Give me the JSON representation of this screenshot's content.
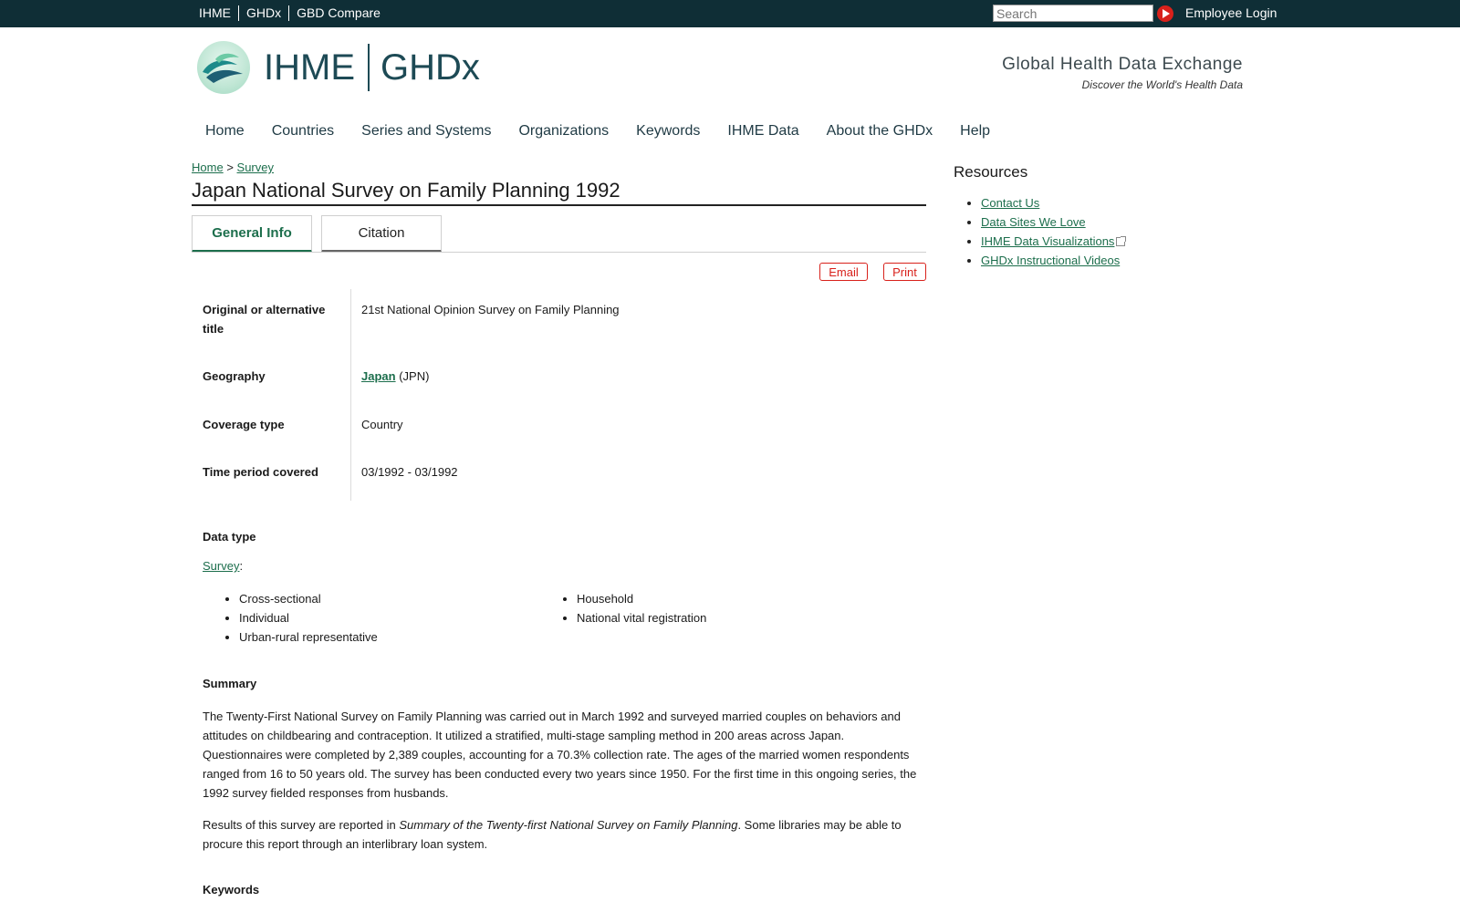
{
  "topbar": {
    "links": [
      "IHME",
      "GHDx",
      "GBD Compare"
    ],
    "search_placeholder": "Search",
    "employee_login": "Employee Login"
  },
  "header": {
    "logo_ihme": "IHME",
    "logo_ghdx": "GHDx",
    "tagline_title": "Global Health Data Exchange",
    "tagline_sub": "Discover the World's Health Data"
  },
  "nav": {
    "items": [
      "Home",
      "Countries",
      "Series and Systems",
      "Organizations",
      "Keywords",
      "IHME Data",
      "About the GHDx",
      "Help"
    ]
  },
  "breadcrumb": {
    "home": "Home",
    "sep": ">",
    "survey": "Survey"
  },
  "page": {
    "title": "Japan National Survey on Family Planning 1992"
  },
  "tabs": {
    "general": "General Info",
    "citation": "Citation"
  },
  "actions": {
    "email": "Email",
    "print": "Print"
  },
  "fields": {
    "alt_title_label": "Original or alternative title",
    "alt_title_value": "21st National Opinion Survey on Family Planning",
    "geography_label": "Geography",
    "geography_link": "Japan",
    "geography_code": "(JPN)",
    "coverage_label": "Coverage type",
    "coverage_value": "Country",
    "time_label": "Time period covered",
    "time_value": "03/1992 - 03/1992"
  },
  "data_type": {
    "label": "Data type",
    "survey_link": "Survey",
    "colon": ":",
    "col1": [
      "Cross-sectional",
      "Individual",
      "Urban-rural representative"
    ],
    "col2": [
      "Household",
      "National vital registration"
    ]
  },
  "summary": {
    "label": "Summary",
    "para1": "The Twenty-First National Survey on Family Planning was carried out in March 1992 and surveyed married couples on behaviors and attitudes on childbearing and contraception. It utilized a stratified, multi-stage sampling method in 200 areas across Japan. Questionnaires were completed by 2,389 couples, accounting for a 70.3% collection rate. The ages of the married women respondents ranged from 16 to 50 years old. The survey has been conducted every two years since 1950. For the first time in this ongoing series, the 1992 survey fielded responses from husbands.",
    "para2_pre": "Results of this survey are reported in ",
    "para2_italic": "Summary of the Twenty-first National Survey on Family Planning",
    "para2_post": ". Some libraries may be able to procure this report through an interlibrary loan system."
  },
  "keywords": {
    "label": "Keywords"
  },
  "resources": {
    "title": "Resources",
    "items": [
      "Contact Us",
      "Data Sites We Love",
      "IHME Data Visualizations",
      "GHDx Instructional Videos"
    ]
  },
  "colors": {
    "topbar": "#0f2e36",
    "link_green": "#1c6e4c",
    "accent_red": "#d8211b"
  }
}
